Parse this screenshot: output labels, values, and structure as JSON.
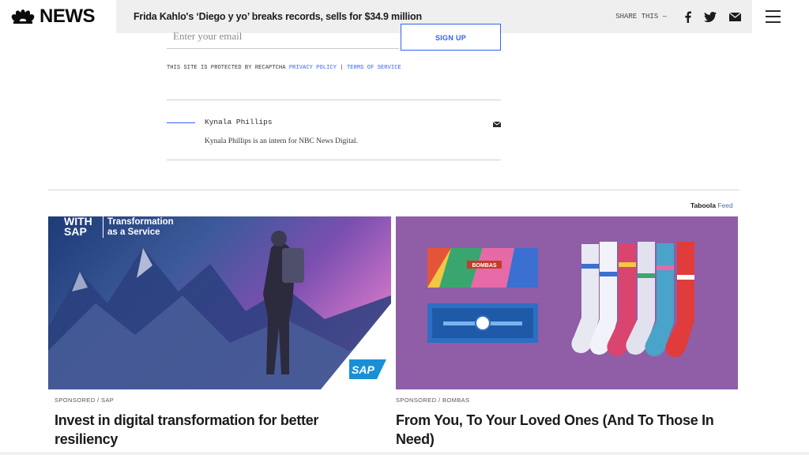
{
  "header": {
    "brand": "NEWS",
    "headline": "Frida Kahlo's ‘Diego y yo’ breaks records, sells for $34.9 million",
    "share_label": "SHARE THIS —",
    "icons": [
      "facebook-icon",
      "twitter-icon",
      "mail-icon",
      "more-icon",
      "menu-icon"
    ]
  },
  "newsletter": {
    "email_placeholder": "Enter your email",
    "signup_label": "SIGN UP",
    "recaptcha_text": "THIS SITE IS PROTECTED BY RECAPTCHA",
    "privacy_link": "PRIVACY POLICY",
    "separator": "|",
    "terms_link": "TERMS OF SERVICE"
  },
  "author": {
    "name": "Kynala Phillips",
    "bio": "Kynala Phillips is an intern for NBC News Digital."
  },
  "taboola": {
    "brand": "Taboola",
    "feed": "Feed"
  },
  "cards": [
    {
      "image_text_1": "WITH",
      "image_text_2": "SAP",
      "image_text_3": "Transformation",
      "image_text_4": "as a Service",
      "image_logo": "SAP",
      "sponsor": "SPONSORED / SAP",
      "title": "Invest in digital transformation for better resiliency"
    },
    {
      "box_label": "BOMBAS",
      "sponsor": "SPONSORED / BOMBAS",
      "title": "From You, To Your Loved Ones (And To Those In Need)"
    }
  ],
  "colors": {
    "accent": "#3061ff",
    "header_bg": "#efefef",
    "sock_bg": "#8f5ea7"
  }
}
